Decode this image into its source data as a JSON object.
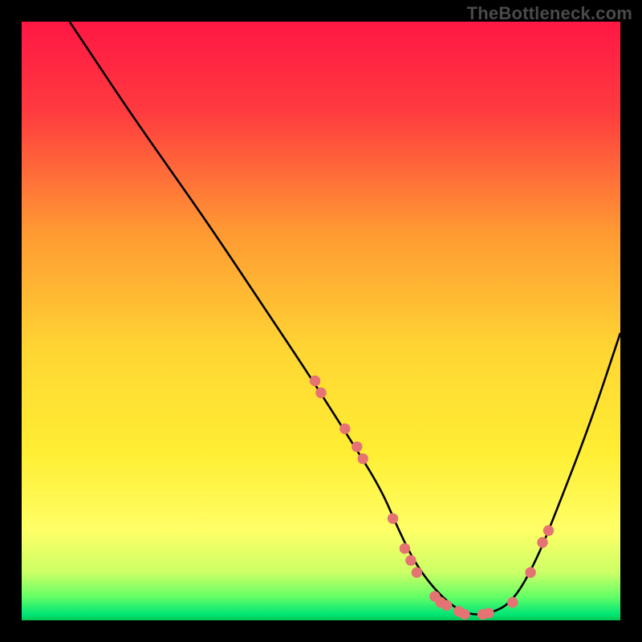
{
  "watermark": "TheBottleneck.com",
  "chart_data": {
    "type": "line",
    "title": "",
    "xlabel": "",
    "ylabel": "",
    "xlim": [
      0,
      100
    ],
    "ylim": [
      0,
      100
    ],
    "gradient_stops": [
      {
        "offset": 0,
        "color": "#ff1744"
      },
      {
        "offset": 15,
        "color": "#ff3b3f"
      },
      {
        "offset": 35,
        "color": "#ff9933"
      },
      {
        "offset": 55,
        "color": "#ffd633"
      },
      {
        "offset": 72,
        "color": "#ffee33"
      },
      {
        "offset": 85,
        "color": "#ffff66"
      },
      {
        "offset": 92,
        "color": "#ccff66"
      },
      {
        "offset": 96,
        "color": "#66ff66"
      },
      {
        "offset": 99,
        "color": "#00e676"
      },
      {
        "offset": 100,
        "color": "#00c853"
      }
    ],
    "series": [
      {
        "name": "bottleneck-curve",
        "x": [
          8,
          12,
          18,
          25,
          32,
          40,
          48,
          55,
          60,
          63,
          66,
          70,
          74,
          78,
          82,
          86,
          90,
          95,
          100
        ],
        "y": [
          100,
          94,
          85,
          75,
          65,
          53,
          41,
          30,
          22,
          15,
          9,
          4,
          1,
          1,
          3,
          10,
          20,
          33,
          48
        ]
      }
    ],
    "markers": [
      {
        "x": 49,
        "y": 40
      },
      {
        "x": 50,
        "y": 38
      },
      {
        "x": 54,
        "y": 32
      },
      {
        "x": 56,
        "y": 29
      },
      {
        "x": 57,
        "y": 27
      },
      {
        "x": 62,
        "y": 17
      },
      {
        "x": 64,
        "y": 12
      },
      {
        "x": 65,
        "y": 10
      },
      {
        "x": 66,
        "y": 8
      },
      {
        "x": 69,
        "y": 4
      },
      {
        "x": 70,
        "y": 3
      },
      {
        "x": 71,
        "y": 2.5
      },
      {
        "x": 73,
        "y": 1.5
      },
      {
        "x": 74,
        "y": 1
      },
      {
        "x": 77,
        "y": 1
      },
      {
        "x": 78,
        "y": 1.2
      },
      {
        "x": 82,
        "y": 3
      },
      {
        "x": 85,
        "y": 8
      },
      {
        "x": 87,
        "y": 13
      },
      {
        "x": 88,
        "y": 15
      }
    ],
    "marker_color": "#e57373",
    "curve_color": "#000000"
  }
}
